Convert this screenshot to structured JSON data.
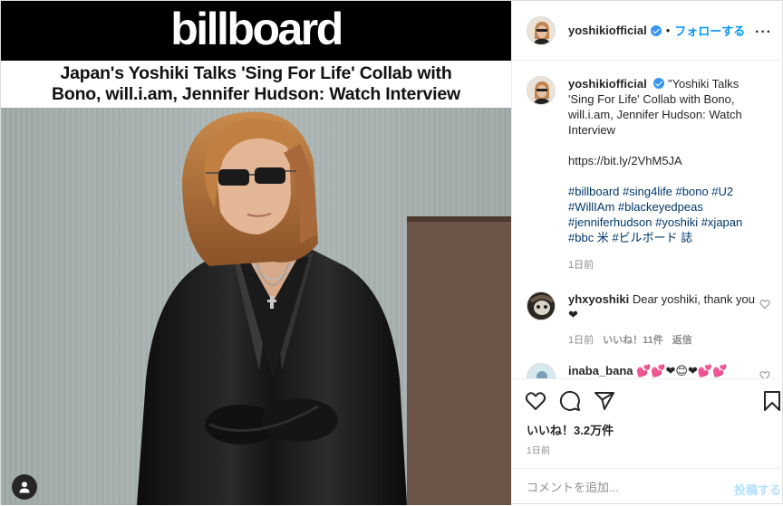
{
  "media": {
    "logo": "billboard",
    "headline_line1": "Japan's Yoshiki Talks 'Sing For Life' Collab with",
    "headline_line2": "Bono, will.i.am, Jennifer Hudson: Watch Interview"
  },
  "header": {
    "username": "yoshikiofficial",
    "separator": "•",
    "follow_label": "フォローする",
    "more_icon": "more-horizontal-icon"
  },
  "caption": {
    "username": "yoshikiofficial",
    "text": "\"Yoshiki Talks 'Sing For Life' Collab with Bono, will.i.am, Jennifer Hudson: Watch Interview",
    "link": "https://bit.ly/2VhM5JA",
    "hashtags": "#billboard #sing4life #bono #U2 #WillIAm #blackeyedpeas #jenniferhudson #yoshiki #xjapan #bbc 米 #ビルボード 誌",
    "time": "1日前"
  },
  "comments": [
    {
      "username": "yhxyoshiki",
      "text": "Dear yoshiki, thank you ❤",
      "time": "1日前",
      "likes": "いいね！11件",
      "reply": "返信"
    },
    {
      "username": "inaba_bana",
      "text": "💕💕❤😊❤💕💕"
    }
  ],
  "actions": {
    "likes_label": "いいね！3.2万件",
    "time_ago": "1日前",
    "comment_placeholder": "コメントを追加...",
    "post_label": "投稿する"
  },
  "colors": {
    "link_blue": "#0095f6",
    "hashtag": "#00376b",
    "muted": "#8e8e8e",
    "post_disabled": "#b2dffc"
  }
}
